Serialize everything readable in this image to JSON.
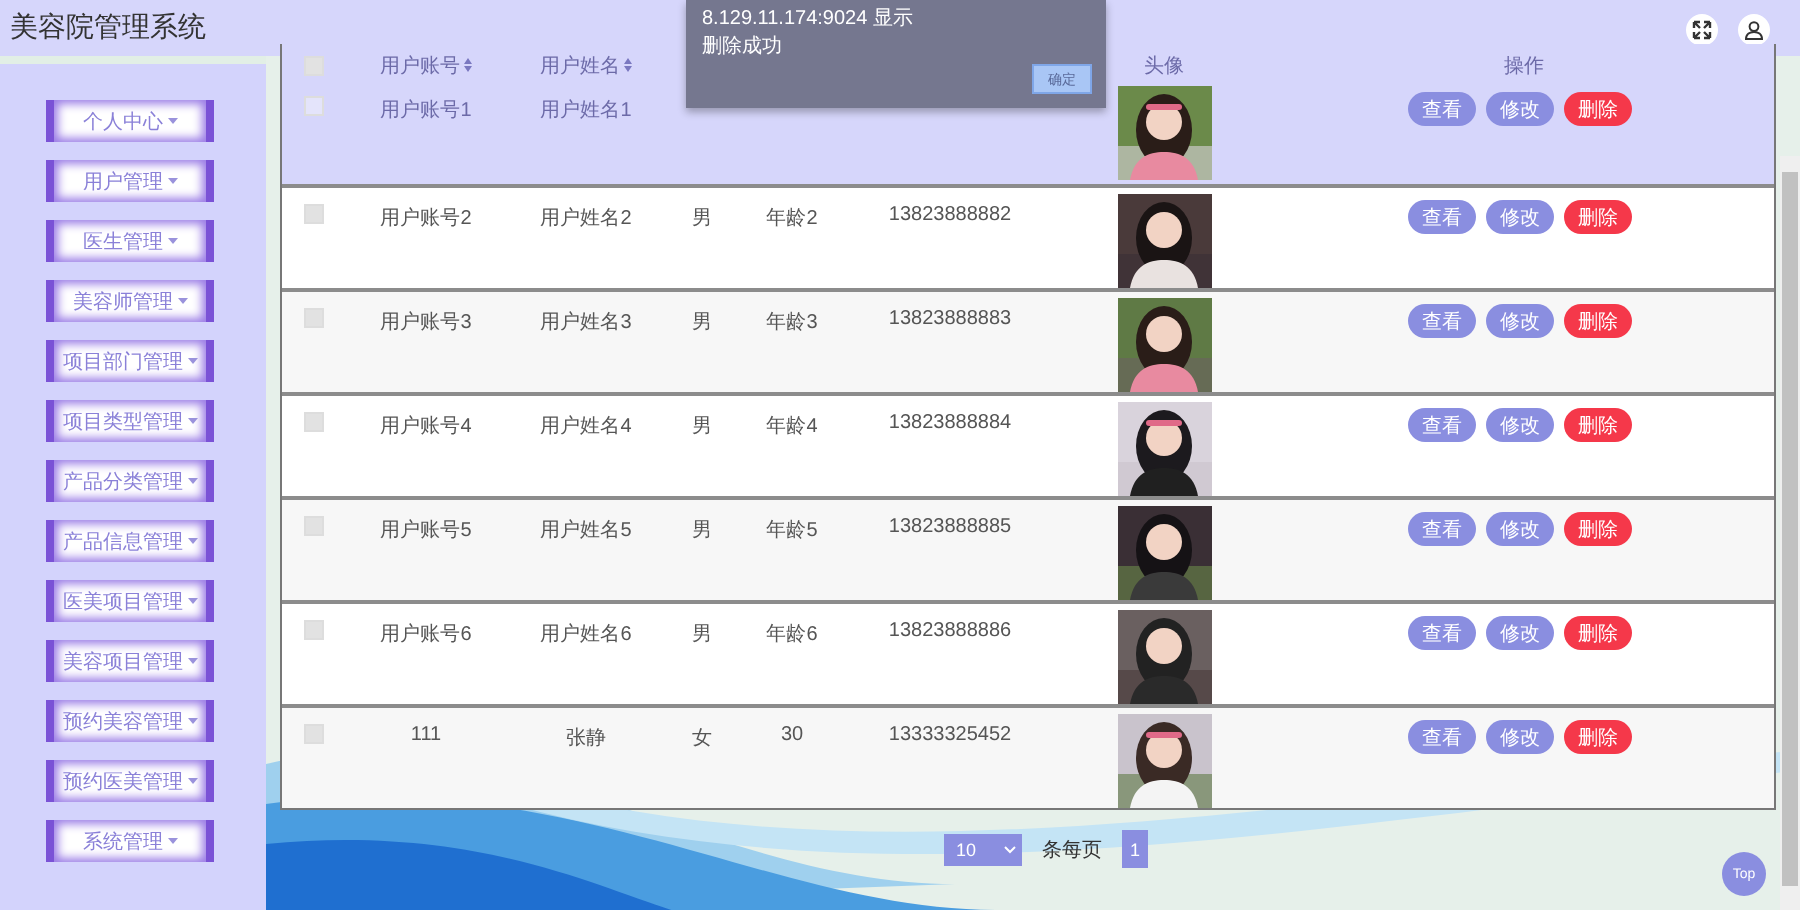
{
  "app": {
    "title": "美容院管理系统"
  },
  "sidebar": {
    "items": [
      {
        "label": "个人中心"
      },
      {
        "label": "用户管理"
      },
      {
        "label": "医生管理"
      },
      {
        "label": "美容师管理"
      },
      {
        "label": "项目部门管理"
      },
      {
        "label": "项目类型管理"
      },
      {
        "label": "产品分类管理"
      },
      {
        "label": "产品信息管理"
      },
      {
        "label": "医美项目管理"
      },
      {
        "label": "美容项目管理"
      },
      {
        "label": "预约美容管理"
      },
      {
        "label": "预约医美管理"
      },
      {
        "label": "系统管理"
      }
    ]
  },
  "table": {
    "select_all": {
      "checked": false
    },
    "header": {
      "account": "用户账号",
      "name": "用户姓名",
      "avatar": "头像",
      "actions": "操作"
    },
    "rows": [
      {
        "checked": false,
        "highlighted": true,
        "account": "用户账号1",
        "name": "用户姓名1",
        "buttons": [
          {
            "label": "查看",
            "kind": "view"
          },
          {
            "label": "修改",
            "kind": "edit"
          },
          {
            "label": "删除",
            "kind": "delete"
          }
        ]
      },
      {
        "checked": false,
        "highlighted": false,
        "account": "用户账号2",
        "name": "用户姓名2",
        "gender": "男",
        "age": "年龄2",
        "phone": "13823888882",
        "buttons": [
          {
            "label": "查看",
            "kind": "view"
          },
          {
            "label": "修改",
            "kind": "edit"
          },
          {
            "label": "删除",
            "kind": "delete"
          }
        ]
      },
      {
        "checked": false,
        "highlighted": false,
        "account": "用户账号3",
        "name": "用户姓名3",
        "gender": "男",
        "age": "年龄3",
        "phone": "13823888883",
        "buttons": [
          {
            "label": "查看",
            "kind": "view"
          },
          {
            "label": "修改",
            "kind": "edit"
          },
          {
            "label": "删除",
            "kind": "delete"
          }
        ]
      },
      {
        "checked": false,
        "highlighted": false,
        "account": "用户账号4",
        "name": "用户姓名4",
        "gender": "男",
        "age": "年龄4",
        "phone": "13823888884",
        "buttons": [
          {
            "label": "查看",
            "kind": "view"
          },
          {
            "label": "修改",
            "kind": "edit"
          },
          {
            "label": "删除",
            "kind": "delete"
          }
        ]
      },
      {
        "checked": false,
        "highlighted": false,
        "account": "用户账号5",
        "name": "用户姓名5",
        "gender": "男",
        "age": "年龄5",
        "phone": "13823888885",
        "buttons": [
          {
            "label": "查看",
            "kind": "view"
          },
          {
            "label": "修改",
            "kind": "edit"
          },
          {
            "label": "删除",
            "kind": "delete"
          }
        ]
      },
      {
        "checked": false,
        "highlighted": false,
        "account": "用户账号6",
        "name": "用户姓名6",
        "gender": "男",
        "age": "年龄6",
        "phone": "13823888886",
        "buttons": [
          {
            "label": "查看",
            "kind": "view"
          },
          {
            "label": "修改",
            "kind": "edit"
          },
          {
            "label": "删除",
            "kind": "delete"
          }
        ]
      },
      {
        "checked": false,
        "highlighted": false,
        "account": "111",
        "name": "张静",
        "gender": "女",
        "age": "30",
        "phone": "13333325452",
        "buttons": [
          {
            "label": "查看",
            "kind": "view"
          },
          {
            "label": "修改",
            "kind": "edit"
          },
          {
            "label": "删除",
            "kind": "delete"
          }
        ]
      }
    ]
  },
  "pagination": {
    "page_size": "10",
    "per_page_label": "条每页",
    "pages": [
      {
        "label": "1",
        "selected": true
      }
    ]
  },
  "top_button": "Top",
  "dialog": {
    "title": "8.129.11.174:9024 显示",
    "message": "删除成功",
    "button": "确定"
  }
}
